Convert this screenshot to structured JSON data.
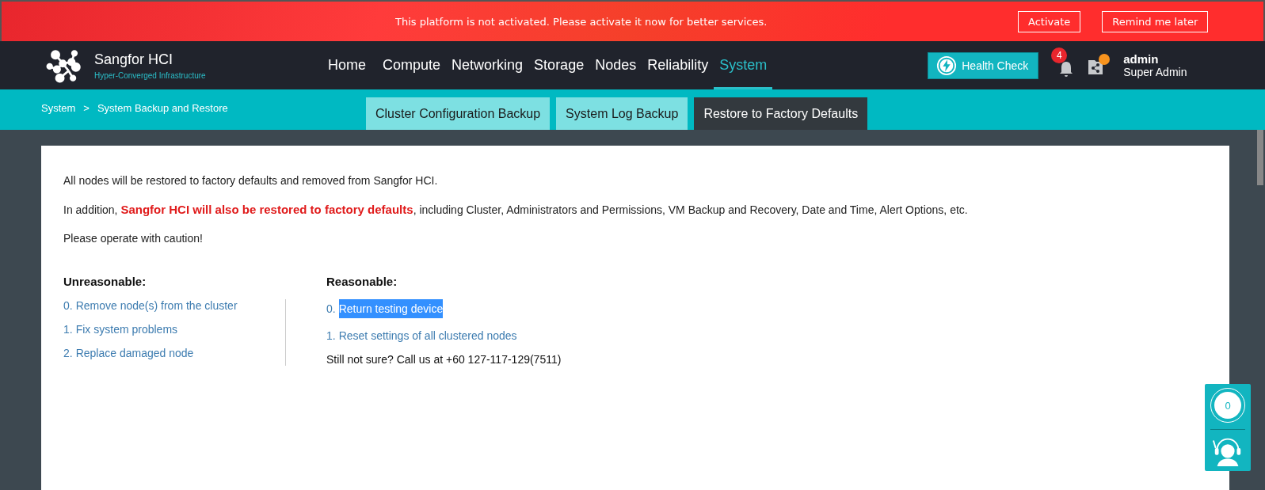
{
  "banner": {
    "message": "This platform is not activated. Please activate it now for better services.",
    "buttons": [
      "Activate",
      "Remind me later"
    ]
  },
  "header": {
    "product": "Sangfor HCI",
    "subtitle": "Hyper-Converged Infrastructure",
    "nav": [
      {
        "label": "Home",
        "selected": false
      },
      {
        "label": "Compute",
        "selected": false
      },
      {
        "label": "Networking",
        "selected": false
      },
      {
        "label": "Storage",
        "selected": false
      },
      {
        "label": "Nodes",
        "selected": false
      },
      {
        "label": "Reliability",
        "selected": false
      },
      {
        "label": "System",
        "selected": true
      }
    ],
    "health_check": "Health Check",
    "notifications": "4",
    "user": {
      "name": "admin",
      "role": "Super Admin"
    }
  },
  "breadcrumb": [
    "System",
    ">",
    "System Backup and Restore"
  ],
  "tabs": [
    {
      "label": "Cluster Configuration Backup",
      "selected": false
    },
    {
      "label": "System Log Backup",
      "selected": false
    },
    {
      "label": "Restore to Factory Defaults",
      "selected": true
    }
  ],
  "paragraphs": [
    "All nodes will be restored to factory defaults and removed from Sangfor HCI.",
    "In addition, **Sangfor HCI will also be restored to factory defaults**, including Cluster, Administrators and Permissions, VM Backup and Recovery, Date and Time, Alert Options, etc.",
    "Please operate with caution!"
  ],
  "columns": [
    {
      "heading": "Unreasonable:",
      "items": [
        {
          "number": "0.",
          "text": "Remove node(s) from the cluster",
          "selected": false
        },
        {
          "number": "1.",
          "text": "Fix system problems",
          "selected": false
        },
        {
          "number": "2.",
          "text": "Replace damaged node",
          "selected": false
        }
      ]
    },
    {
      "heading": "Reasonable:",
      "items": [
        {
          "number": "0.",
          "text": "Return testing device",
          "selected": true
        },
        {
          "number": "1.",
          "text": "Reset settings of all clustered nodes",
          "selected": false
        }
      ],
      "note": "Still not sure? Call us at +60 127-117-129(7511)"
    }
  ],
  "widget": {
    "count": "0"
  }
}
